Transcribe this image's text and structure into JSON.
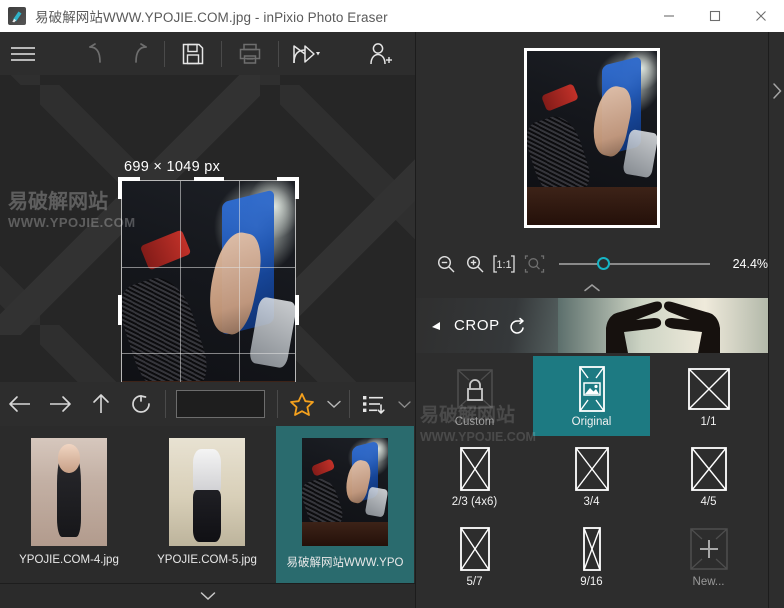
{
  "window": {
    "title": "易破解网站WWW.YPOJIE.COM.jpg - inPixio Photo Eraser",
    "app_icon": "app-icon",
    "controls": {
      "minimize": "minimize-icon",
      "maximize": "maximize-icon",
      "close": "close-icon"
    }
  },
  "toolbar": {
    "menu": "hamburger-menu-icon",
    "undo": "undo-icon",
    "redo": "redo-icon",
    "save": "save-icon",
    "print": "print-icon",
    "share": "share-icon",
    "share_caret": "caret-down-icon",
    "add_user": "add-user-icon"
  },
  "canvas": {
    "dimension_label": "699 × 1049 px",
    "watermark_line1": "易破解网站",
    "watermark_line2": "WWW.YPOJIE.COM"
  },
  "browser_toolbar": {
    "back": "back-arrow-icon",
    "forward": "forward-arrow-icon",
    "up": "up-arrow-icon",
    "refresh": "refresh-icon",
    "path_value": "",
    "path_placeholder": "",
    "favorites": "star-icon",
    "favorites_caret": "caret-down-icon",
    "sort": "sort-list-icon",
    "sort_caret": "caret-down-icon"
  },
  "filmstrip": {
    "items": [
      {
        "label": "YPOJIE.COM-4.jpg",
        "selected": false
      },
      {
        "label": "YPOJIE.COM-5.jpg",
        "selected": false
      },
      {
        "label": "易破解网站WWW.YPO",
        "selected": true
      }
    ],
    "expand": "chevron-down-icon"
  },
  "right_panel": {
    "preview": "image-preview",
    "zoom": {
      "zoom_out": "zoom-out-icon",
      "zoom_in": "zoom-in-icon",
      "actual_size": "1:1",
      "fit_window": "fit-to-window-icon",
      "percent": "24.4%",
      "slider_value": 24.4
    },
    "collapse": "chevron-up-icon",
    "section": {
      "collapse_triangle": "triangle-left-icon",
      "title": "CROP",
      "reset": "reset-icon"
    },
    "presets": [
      {
        "label": "Custom",
        "glyph": "lock-icon",
        "selected": false,
        "dim": true
      },
      {
        "label": "Original",
        "glyph": "original-image-icon",
        "selected": true,
        "dim": false
      },
      {
        "label": "1/1",
        "glyph": "ratio-1-1-icon",
        "selected": false,
        "dim": false
      },
      {
        "label": "2/3 (4x6)",
        "glyph": "ratio-2-3-icon",
        "selected": false,
        "dim": false
      },
      {
        "label": "3/4",
        "glyph": "ratio-3-4-icon",
        "selected": false,
        "dim": false
      },
      {
        "label": "4/5",
        "glyph": "ratio-4-5-icon",
        "selected": false,
        "dim": false
      },
      {
        "label": "5/7",
        "glyph": "ratio-5-7-icon",
        "selected": false,
        "dim": false
      },
      {
        "label": "9/16",
        "glyph": "ratio-9-16-icon",
        "selected": false,
        "dim": false
      },
      {
        "label": "New...",
        "glyph": "plus-icon",
        "selected": false,
        "dim": true
      }
    ],
    "edge_expand": "chevron-right-icon",
    "watermark_line1": "易破解网站",
    "watermark_line2": "WWW.YPOJIE.COM"
  },
  "colors": {
    "accent_teal": "#1d7a82",
    "selection_teal": "#2a6b6e",
    "slider_teal": "#16b4c4",
    "star_orange": "#f5a11d",
    "panel_bg": "#2d2d2d",
    "canvas_bg": "#262626",
    "titlebar_bg": "#ffffff"
  }
}
